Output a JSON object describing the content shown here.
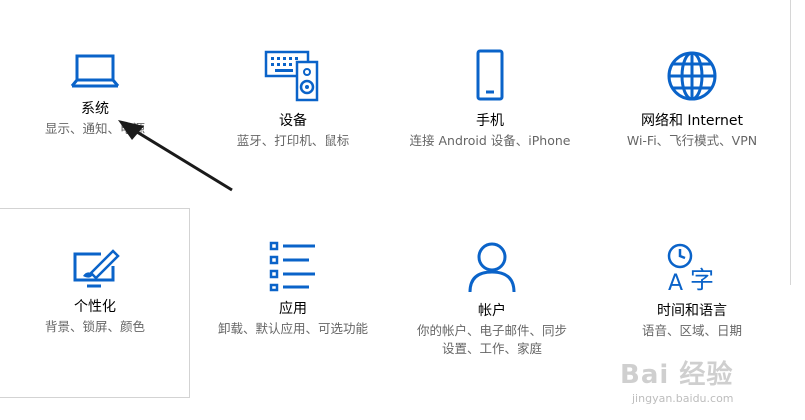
{
  "accent_color": "#0a63c9",
  "tiles": [
    {
      "title": "系统",
      "desc": "显示、通知、电源",
      "icon": "laptop-icon"
    },
    {
      "title": "设备",
      "desc": "蓝牙、打印机、鼠标",
      "icon": "devices-icon"
    },
    {
      "title": "手机",
      "desc": "连接 Android 设备、iPhone",
      "icon": "phone-icon"
    },
    {
      "title": "网络和 Internet",
      "desc": "Wi-Fi、飞行模式、VPN",
      "icon": "globe-icon"
    },
    {
      "title": "个性化",
      "desc": "背景、锁屏、颜色",
      "icon": "personalization-icon"
    },
    {
      "title": "应用",
      "desc": "卸载、默认应用、可选功能",
      "icon": "apps-list-icon"
    },
    {
      "title": "帐户",
      "desc": "你的帐户、电子邮件、同步设置、工作、家庭",
      "icon": "account-icon"
    },
    {
      "title": "时间和语言",
      "desc": "语音、区域、日期",
      "icon": "time-language-icon"
    }
  ],
  "watermark": {
    "main": "Bai 经验",
    "sub": "jingyan.baidu.com"
  }
}
